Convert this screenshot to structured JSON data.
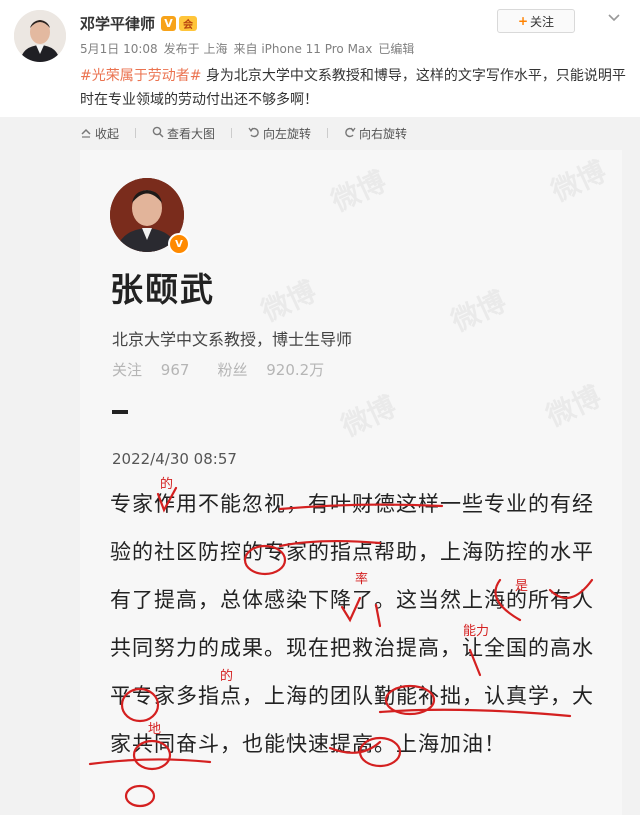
{
  "post": {
    "author_name": "邓学平律师",
    "verified_badge": "V",
    "vip_badge": "会",
    "meta": {
      "date": "5月1日 10:08",
      "published_in": "发布于 上海",
      "source": "来自 iPhone 11 Pro Max",
      "edited": "已编辑"
    },
    "follow_label": "关注",
    "follow_plus": "+",
    "more_icon": "chevron-down-icon",
    "topic": "#光荣属于劳动者#",
    "text": " 身为北京大学中文系教授和博导，这样的文字写作水平，只能说明平时在专业领域的劳动付出还不够多啊！"
  },
  "toolbar": {
    "collapse": "收起",
    "view_large": "查看大图",
    "rotate_left": "向左旋转",
    "rotate_right": "向右旋转"
  },
  "screenshot": {
    "name": "张颐武",
    "bio": "北京大学中文系教授，博士生导师",
    "following_label": "关注",
    "following_value": "967",
    "followers_label": "粉丝",
    "followers_value": "920.2万",
    "date": "2022/4/30 08:57",
    "body": "专家作用不能忽视，有叶财德这样一些专业的有经验的社区防控的专家的指点帮助，上海防控的水平有了提高，总体感染下降了。这当然上海的所有人共同努力的成果。现在把救治提高，让全国的高水平专家多指点，上海的团队勤能补拙，认真学，大家共同奋斗，也能快速提高。上海加油！",
    "watermark": "微博",
    "annotations": {
      "de1": "的",
      "lv": "率",
      "shi": "是",
      "nengli": "能力",
      "de2": "的",
      "di": "地"
    }
  },
  "colors": {
    "accent_orange": "#ff8200",
    "topic_color": "#eb7350",
    "annotation_red": "#d42020"
  }
}
